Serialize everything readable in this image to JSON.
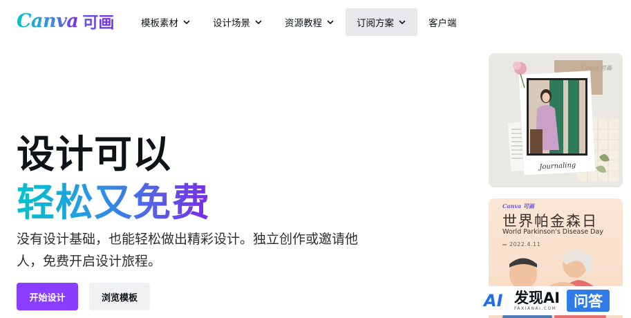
{
  "header": {
    "logo_word": "Canva",
    "logo_cn": "可画",
    "nav": [
      {
        "label": "模板素材",
        "has_dropdown": true
      },
      {
        "label": "设计场景",
        "has_dropdown": true
      },
      {
        "label": "资源教程",
        "has_dropdown": true
      },
      {
        "label": "订阅方案",
        "has_dropdown": true,
        "active": true
      },
      {
        "label": "客户端",
        "has_dropdown": false
      }
    ]
  },
  "hero": {
    "title_line1": "设计可以",
    "title_line2": "轻松又免费",
    "subtitle": "没有设计基础，也能轻松做出精彩设计。独立创作或邀请他人，免费开启设计旅程。",
    "primary_button": "开始设计",
    "secondary_button": "浏览模板"
  },
  "templates": [
    {
      "logo": "Canva 可画",
      "script_text": "Journaling"
    },
    {
      "logo": "Canva 可画",
      "title": "世界帕金森日",
      "subtitle": "World Parkinson's Disease Day",
      "date": "2022.4.11"
    }
  ],
  "watermark": {
    "mark": "AI",
    "main": "发现AI",
    "url": "FAXIANAI.COM",
    "badge": "问答"
  },
  "colors": {
    "brand_purple": "#8b3dff",
    "gradient_start": "#00c4cc",
    "gradient_end": "#7d2ae8",
    "watermark_blue": "#2f7be8"
  }
}
